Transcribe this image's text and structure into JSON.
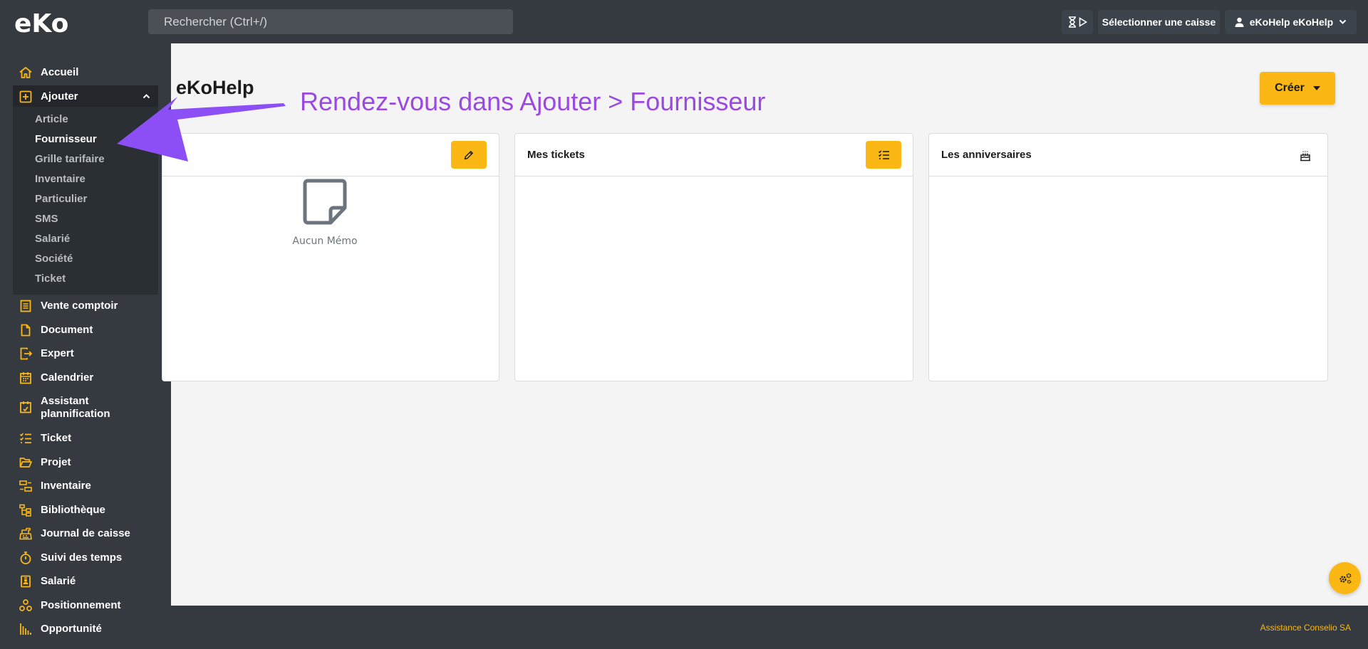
{
  "topbar": {
    "logo_text": "eko",
    "search_placeholder": "Rechercher (Ctrl+/)",
    "select_register": "Sélectionner une caisse",
    "user_name": "eKoHelp eKoHelp"
  },
  "sidebar": {
    "items": [
      {
        "label": "Accueil",
        "icon": "home-icon"
      },
      {
        "label": "Ajouter",
        "icon": "plus-square-icon"
      },
      {
        "label": "Vente comptoir",
        "icon": "receipt-icon"
      },
      {
        "label": "Document",
        "icon": "file-icon"
      },
      {
        "label": "Expert",
        "icon": "export-icon"
      },
      {
        "label": "Calendrier",
        "icon": "calendar-icon"
      },
      {
        "label": "Assistant plannification",
        "icon": "calendar-check-icon"
      },
      {
        "label": "Ticket",
        "icon": "list-check-icon"
      },
      {
        "label": "Projet",
        "icon": "folder-open-icon"
      },
      {
        "label": "Inventaire",
        "icon": "boxes-icon"
      },
      {
        "label": "Bibliothèque",
        "icon": "sitemap-icon"
      },
      {
        "label": "Journal de caisse",
        "icon": "cash-register-icon"
      },
      {
        "label": "Suivi des temps",
        "icon": "stopwatch-icon"
      },
      {
        "label": "Salarié",
        "icon": "id-badge-icon"
      },
      {
        "label": "Positionnement",
        "icon": "network-icon"
      },
      {
        "label": "Opportunité",
        "icon": "chart-bars-icon"
      }
    ],
    "ajouter_sub": [
      "Article",
      "Fournisseur",
      "Grille tarifaire",
      "Inventaire",
      "Particulier",
      "SMS",
      "Salarié",
      "Société",
      "Ticket"
    ],
    "active_sub": "Fournisseur"
  },
  "main": {
    "title": "eKoHelp",
    "annotation": "Rendez-vous dans Ajouter > Fournisseur",
    "create_label": "Créer",
    "cards": [
      {
        "title": "",
        "empty_text": "Aucun Mémo",
        "button_icon": "pencil-icon"
      },
      {
        "title": "Mes tickets",
        "button_icon": "list-check-icon"
      },
      {
        "title": "Les anniversaires",
        "button_icon": "birthday-cake-icon"
      }
    ]
  },
  "footer": {
    "text": "Assistance Conselio SA"
  },
  "colors": {
    "accent": "#fbb714",
    "sidebar_bg": "#343a40",
    "annotation": "#9b4ae0",
    "arrow": "#8c4ff5"
  }
}
